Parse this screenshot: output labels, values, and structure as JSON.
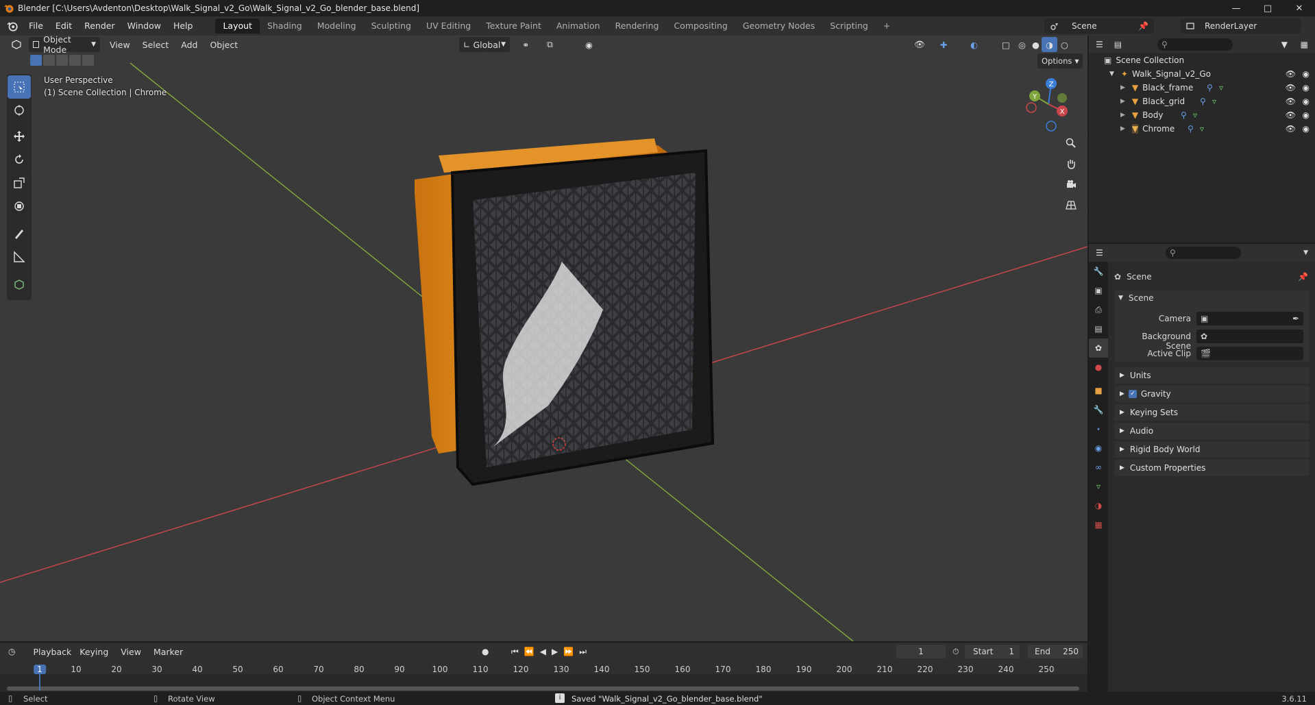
{
  "window": {
    "title": "Blender [C:\\Users\\Avdenton\\Desktop\\Walk_Signal_v2_Go\\Walk_Signal_v2_Go_blender_base.blend]",
    "buttons": [
      "minimize-icon",
      "maximize-icon",
      "close-icon"
    ]
  },
  "menus": [
    "File",
    "Edit",
    "Render",
    "Window",
    "Help"
  ],
  "workspaces": [
    {
      "label": "Layout",
      "active": true
    },
    {
      "label": "Shading",
      "active": false
    },
    {
      "label": "Modeling",
      "active": false
    },
    {
      "label": "Sculpting",
      "active": false
    },
    {
      "label": "UV Editing",
      "active": false
    },
    {
      "label": "Texture Paint",
      "active": false
    },
    {
      "label": "Animation",
      "active": false
    },
    {
      "label": "Rendering",
      "active": false
    },
    {
      "label": "Compositing",
      "active": false
    },
    {
      "label": "Geometry Nodes",
      "active": false
    },
    {
      "label": "Scripting",
      "active": false
    }
  ],
  "add_workspace": "+",
  "scene_selector": {
    "value": "Scene"
  },
  "view_layer": {
    "value": "RenderLayer"
  },
  "viewport": {
    "mode": "Object Mode",
    "menus": [
      "View",
      "Select",
      "Add",
      "Object"
    ],
    "transform_orientation": "Global",
    "options_label": "Options",
    "overlay_line1": "User Perspective",
    "overlay_line2": "(1) Scene Collection | Chrome",
    "gizmo_axes": {
      "z": "Z",
      "y": "Y",
      "x": "X"
    },
    "colors": {
      "x_axis": "#c8464c",
      "y_axis": "#7ea63c",
      "z_axis": "#3a7ed8",
      "background": "#3a3a3a",
      "active_tool": "#4772b3"
    }
  },
  "tools": [
    "select-box-icon",
    "cursor-icon",
    "move-icon",
    "rotate-icon",
    "scale-icon",
    "transform-icon",
    "annotate-icon",
    "measure-icon",
    "add-cube-icon"
  ],
  "outliner": {
    "root": "Scene Collection",
    "collection": "Walk_Signal_v2_Go",
    "objects": [
      "Black_frame",
      "Black_grid",
      "Body",
      "Chrome"
    ]
  },
  "properties": {
    "context_title": "Scene",
    "scene_panel": "Scene",
    "camera_label": "Camera",
    "background_scene_label": "Background Scene",
    "active_clip_label": "Active Clip",
    "panels": [
      "Units",
      "Gravity",
      "Keying Sets",
      "Audio",
      "Rigid Body World",
      "Custom Properties"
    ],
    "gravity_checked": true
  },
  "timeline": {
    "menus": [
      "Playback",
      "Keying",
      "View",
      "Marker"
    ],
    "current_frame": "1",
    "start_label": "Start",
    "start_value": "1",
    "end_label": "End",
    "end_value": "250",
    "ruler": [
      "1",
      "10",
      "20",
      "30",
      "40",
      "50",
      "60",
      "70",
      "80",
      "90",
      "100",
      "110",
      "120",
      "130",
      "140",
      "150",
      "160",
      "170",
      "180",
      "190",
      "200",
      "210",
      "220",
      "230",
      "240",
      "250"
    ]
  },
  "statusbar": {
    "select": "Select",
    "rotate": "Rotate View",
    "context": "Object Context Menu",
    "message": "Saved \"Walk_Signal_v2_Go_blender_base.blend\"",
    "version": "3.6.11"
  }
}
